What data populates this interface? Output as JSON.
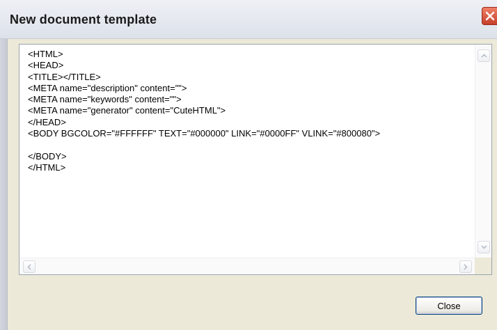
{
  "window": {
    "title": "New document template",
    "close_icon": "close-icon"
  },
  "editor": {
    "content": "<HTML>\n<HEAD>\n<TITLE></TITLE>\n<META name=\"description\" content=\"\">\n<META name=\"keywords\" content=\"\">\n<META name=\"generator\" content=\"CuteHTML\">\n</HEAD>\n<BODY BGCOLOR=\"#FFFFFF\" TEXT=\"#000000\" LINK=\"#0000FF\" VLINK=\"#800080\">\n\n</BODY>\n</HTML>"
  },
  "scrollbars": {
    "up_icon": "arrow-up-icon",
    "down_icon": "arrow-down-icon",
    "left_icon": "arrow-left-icon",
    "right_icon": "arrow-right-icon"
  },
  "footer": {
    "close_label": "Close"
  },
  "colors": {
    "titlebar": "#dde2ea",
    "dialog_bg": "#ece9d8",
    "close_icon_red": "#c5402a",
    "button_border": "#003c74"
  }
}
